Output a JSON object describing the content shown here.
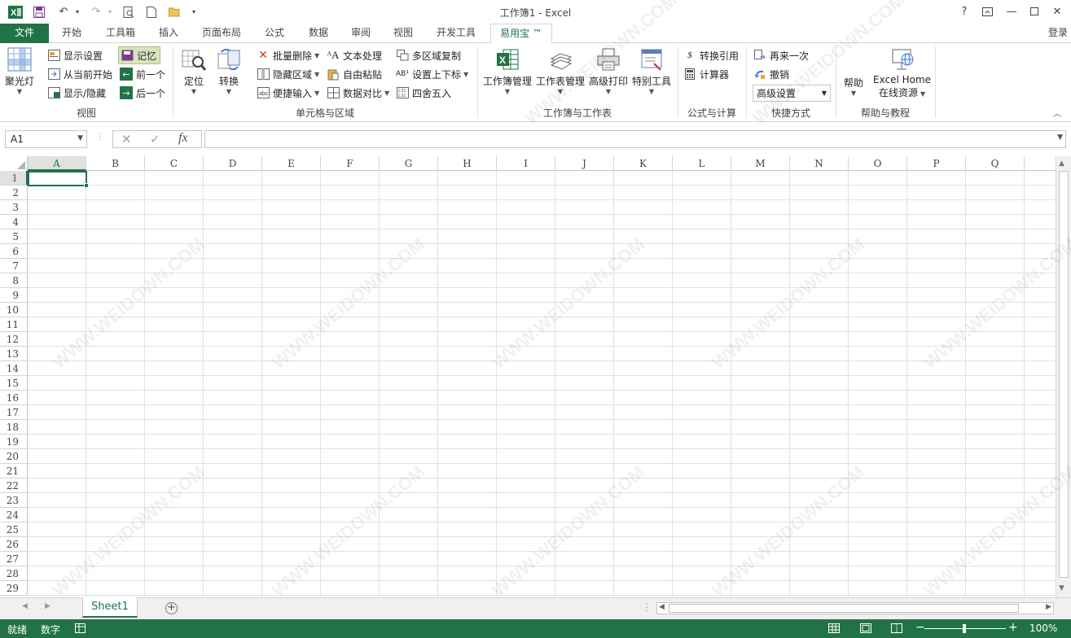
{
  "window": {
    "title": "工作簿1 - Excel",
    "help": "?",
    "login": "登录"
  },
  "tabs": [
    "文件",
    "开始",
    "工具箱",
    "插入",
    "页面布局",
    "公式",
    "数据",
    "审阅",
    "视图",
    "开发工具",
    "易用宝 ™"
  ],
  "ribbon": {
    "view": {
      "label": "视图",
      "spotlight": "聚光灯",
      "show_settings": "显示设置",
      "from_current": "从当前开始",
      "show_hide": "显示/隐藏",
      "memory": "记忆",
      "prev": "前一个",
      "next": "后一个"
    },
    "cells": {
      "label": "单元格与区域",
      "locate": "定位",
      "convert": "转换",
      "batch_delete": "批量删除",
      "hide_region": "隐藏区域",
      "quick_input": "便捷输入",
      "text_process": "文本处理",
      "free_paste": "自由粘贴",
      "data_compare": "数据对比",
      "multi_copy": "多区域复制",
      "sub_super": "设置上下标",
      "rounding": "四舍五入"
    },
    "workbook": {
      "label": "工作簿与工作表",
      "wb_manage": "工作簿管理",
      "ws_manage": "工作表管理",
      "adv_print": "高级打印",
      "special_tools": "特别工具"
    },
    "formula": {
      "label": "公式与计算",
      "convert_ref": "转换引用",
      "calculator": "计算器"
    },
    "shortcut": {
      "label": "快捷方式",
      "redo_again": "再来一次",
      "undo": "撤销",
      "advanced": "高级设置"
    },
    "help": {
      "label": "帮助与教程",
      "help": "帮助",
      "eh_line1": "Excel Home",
      "eh_line2": "在线资源"
    }
  },
  "formula_bar": {
    "name_box": "A1",
    "fx": "fx",
    "value": ""
  },
  "grid": {
    "columns": [
      "A",
      "B",
      "C",
      "D",
      "E",
      "F",
      "G",
      "H",
      "I",
      "J",
      "K",
      "L",
      "M",
      "N",
      "O",
      "P",
      "Q"
    ],
    "rows": [
      "1",
      "2",
      "3",
      "4",
      "5",
      "6",
      "7",
      "8",
      "9",
      "10",
      "11",
      "12",
      "13",
      "14",
      "15",
      "16",
      "17",
      "18",
      "19",
      "20",
      "21",
      "22",
      "23",
      "24",
      "25",
      "26",
      "27",
      "28",
      "29"
    ],
    "active_cell": "A1"
  },
  "sheets": [
    "Sheet1"
  ],
  "status": {
    "ready": "就绪",
    "mode": "数字",
    "zoom": "100%"
  },
  "colors": {
    "accent": "#217346",
    "memory_bg": "#d7e4bd"
  },
  "watermark": "WWW.WEIDOWN.COM"
}
